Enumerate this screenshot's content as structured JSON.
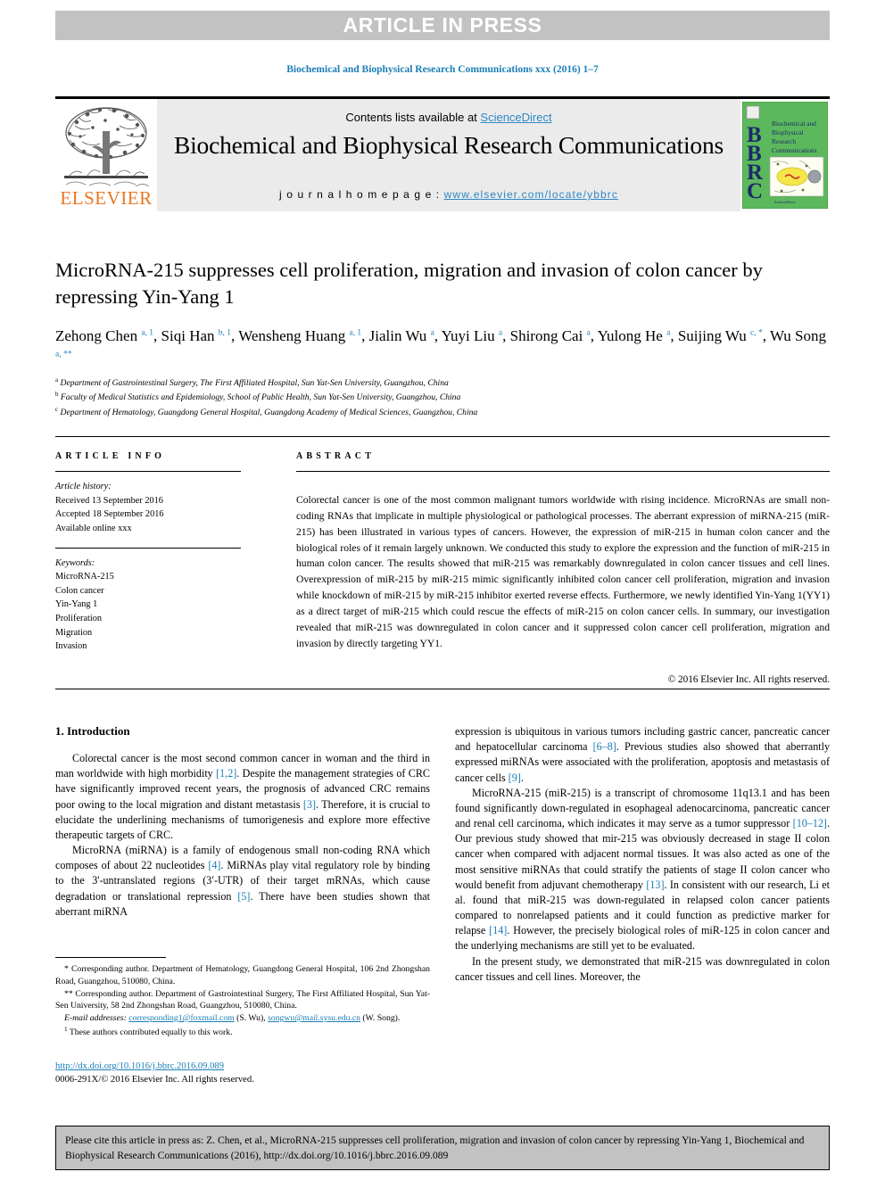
{
  "banner": {
    "label": "ARTICLE IN PRESS"
  },
  "running_head": "Biochemical and Biophysical Research Communications xxx (2016) 1–7",
  "masthead": {
    "contents_prefix": "Contents lists available at ",
    "sciencedirect": "ScienceDirect",
    "journal_title": "Biochemical and Biophysical Research Communications",
    "homepage_label": "j o u r n a l   h o m e p a g e :   ",
    "homepage_url": "www.elsevier.com/locate/ybbrc",
    "elsevier_wordmark": "ELSEVIER",
    "cover": {
      "letters": "BBRC",
      "title_lines": [
        "Biochemical and",
        "Biophysical",
        "Research",
        "Communications"
      ],
      "background_color": "#5cb85c"
    }
  },
  "title": "MicroRNA-215 suppresses cell proliferation, migration and invasion of colon cancer by repressing Yin-Yang 1",
  "authors": [
    {
      "name": "Zehong Chen",
      "marks": "a, 1"
    },
    {
      "name": "Siqi Han",
      "marks": "b, 1"
    },
    {
      "name": "Wensheng Huang",
      "marks": "a, 1"
    },
    {
      "name": "Jialin Wu",
      "marks": "a"
    },
    {
      "name": "Yuyi Liu",
      "marks": "a"
    },
    {
      "name": "Shirong Cai",
      "marks": "a"
    },
    {
      "name": "Yulong He",
      "marks": "a"
    },
    {
      "name": "Suijing Wu",
      "marks": "c, *"
    },
    {
      "name": "Wu Song",
      "marks": "a, **"
    }
  ],
  "affiliations": [
    {
      "mark": "a",
      "text": "Department of Gastrointestinal Surgery, The First Affiliated Hospital, Sun Yat-Sen University, Guangzhou, China"
    },
    {
      "mark": "b",
      "text": "Faculty of Medical Statistics and Epidemiology, School of Public Health, Sun Yat-Sen University, Guangzhou, China"
    },
    {
      "mark": "c",
      "text": "Department of Hematology, Guangdong General Hospital, Guangdong Academy of Medical Sciences, Guangzhou, China"
    }
  ],
  "article_info": {
    "heading": "ARTICLE INFO",
    "history_label": "Article history:",
    "history": [
      "Received 13 September 2016",
      "Accepted 18 September 2016",
      "Available online xxx"
    ],
    "keywords_label": "Keywords:",
    "keywords": [
      "MicroRNA-215",
      "Colon cancer",
      "Yin-Yang 1",
      "Proliferation",
      "Migration",
      "Invasion"
    ]
  },
  "abstract": {
    "heading": "ABSTRACT",
    "text": "Colorectal cancer is one of the most common malignant tumors worldwide with rising incidence. MicroRNAs are small non-coding RNAs that implicate in multiple physiological or pathological processes. The aberrant expression of miRNA-215 (miR-215) has been illustrated in various types of cancers. However, the expression of miR-215 in human colon cancer and the biological roles of it remain largely unknown. We conducted this study to explore the expression and the function of miR-215 in human colon cancer. The results showed that miR-215 was remarkably downregulated in colon cancer tissues and cell lines. Overexpression of miR-215 by miR-215 mimic significantly inhibited colon cancer cell proliferation, migration and invasion while knockdown of miR-215 by miR-215 inhibitor exerted reverse effects. Furthermore, we newly identified Yin-Yang 1(YY1) as a direct target of miR-215 which could rescue the effects of miR-215 on colon cancer cells. In summary, our investigation revealed that miR-215 was downregulated in colon cancer and it suppressed colon cancer cell proliferation, migration and invasion by directly targeting YY1.",
    "copyright": "© 2016 Elsevier Inc. All rights reserved."
  },
  "introduction": {
    "heading": "1. Introduction",
    "left_paragraphs": [
      "Colorectal cancer is the most second common cancer in woman and the third in man worldwide with high morbidity [1,2]. Despite the management strategies of CRC have significantly improved recent years, the prognosis of advanced CRC remains poor owing to the local migration and distant metastasis [3]. Therefore, it is crucial to elucidate the underlining mechanisms of tumorigenesis and explore more effective therapeutic targets of CRC.",
      "MicroRNA (miRNA) is a family of endogenous small non-coding RNA which composes of about 22 nucleotides [4]. MiRNAs play vital regulatory role by binding to the 3'-untranslated regions (3′-UTR) of their target mRNAs, which cause degradation or translational repression [5]. There have been studies shown that aberrant miRNA"
    ],
    "right_paragraphs": [
      "expression is ubiquitous in various tumors including gastric cancer, pancreatic cancer and hepatocellular carcinoma [6–8]. Previous studies also showed that aberrantly expressed miRNAs were associated with the proliferation, apoptosis and metastasis of cancer cells [9].",
      "MicroRNA-215 (miR-215) is a transcript of chromosome 11q13.1 and has been found significantly down-regulated in esophageal adenocarcinoma, pancreatic cancer and renal cell carcinoma, which indicates it may serve as a tumor suppressor [10–12]. Our previous study showed that mir-215 was obviously decreased in stage II colon cancer when compared with adjacent normal tissues. It was also acted as one of the most sensitive miRNAs that could stratify the patients of stage II colon cancer who would benefit from adjuvant chemotherapy [13]. In consistent with our research, Li et al. found that miR-215 was down-regulated in relapsed colon cancer patients compared to nonrelapsed patients and it could function as predictive marker for relapse [14]. However, the precisely biological roles of miR-125 in colon cancer and the underlying mechanisms are still yet to be evaluated.",
      "In the present study, we demonstrated that miR-215 was downregulated in colon cancer tissues and cell lines. Moreover, the"
    ]
  },
  "footnotes": {
    "corresponding_1": "* Corresponding author. Department of Hematology, Guangdong General Hospital, 106 2nd Zhongshan Road, Guangzhou, 510080, China.",
    "corresponding_2": "** Corresponding author. Department of Gastrointestinal Surgery, The First Affiliated Hospital, Sun Yat-Sen University, 58 2nd Zhongshan Road, Guangzhou, 510080, China.",
    "email_label": "E-mail addresses:",
    "email_1": "corresponding1@foxmail.com",
    "email_1_owner": "(S. Wu)",
    "email_2": "songwu@mail.sysu.edu.cn",
    "email_2_owner": "(W. Song).",
    "equal_contrib": "These authors contributed equally to this work.",
    "equal_contrib_mark": "1"
  },
  "doi_block": {
    "doi_url": "http://dx.doi.org/10.1016/j.bbrc.2016.09.089",
    "issn_line": "0006-291X/© 2016 Elsevier Inc. All rights reserved."
  },
  "cite_box": {
    "text": "Please cite this article in press as: Z. Chen, et al., MicroRNA-215 suppresses cell proliferation, migration and invasion of colon cancer by repressing Yin-Yang 1, Biochemical and Biophysical Research Communications (2016), http://dx.doi.org/10.1016/j.bbrc.2016.09.089"
  },
  "colors": {
    "link_blue": "#1a7db6",
    "elsevier_orange": "#e87722",
    "banner_gray": "#c2c2c2",
    "band_gray": "#ebebeb"
  }
}
